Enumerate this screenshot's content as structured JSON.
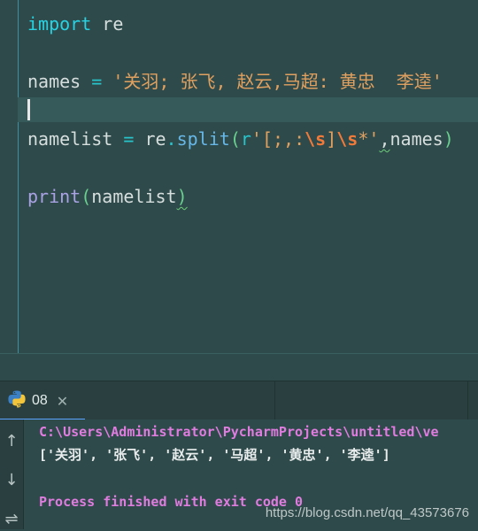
{
  "editor": {
    "line1": {
      "kw": "import",
      "rest": " re"
    },
    "line3": {
      "ident": "names",
      "op": " = ",
      "string": "'关羽; 张飞, 赵云,马超: 黄忠  李逵'"
    },
    "line5": {
      "ident": "namelist",
      "op": " = ",
      "module": "re",
      "dot": ".",
      "func": "split",
      "open": "(",
      "prefix": "r",
      "str_a": "'[;,:",
      "esc1": "\\s",
      "str_b": "]",
      "esc2": "\\s",
      "str_c": "*'",
      "comma": ",",
      "arg": "names",
      "close": ")"
    },
    "line7": {
      "builtin": "print",
      "open": "(",
      "arg": "namelist",
      "close": ")"
    }
  },
  "tool_window": {
    "tab_label": "08",
    "close_glyph": "✕"
  },
  "console": {
    "command": "C:\\Users\\Administrator\\PycharmProjects\\untitled\\ve",
    "output": "['关羽', '张飞', '赵云', '马超', '黄忠', '李逵']",
    "exit_message": "Process finished with exit code 0",
    "toolbar": {
      "up_glyph": "↑",
      "down_glyph": "↓",
      "wrap_glyph": "⇌"
    }
  },
  "watermark": "https://blog.csdn.net/qq_43573676"
}
